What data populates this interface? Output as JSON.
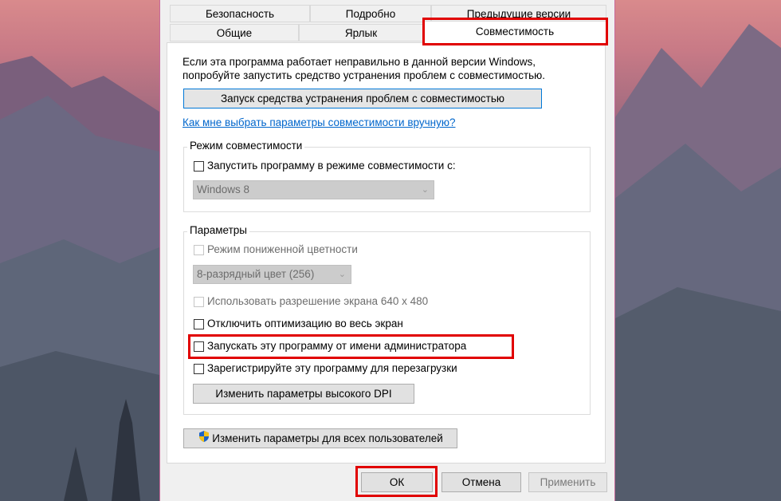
{
  "tabs": {
    "row1": [
      "Безопасность",
      "Подробно",
      "Предыдущие версии"
    ],
    "row2": [
      "Общие",
      "Ярлык",
      "Совместимость"
    ]
  },
  "description": {
    "line1": "Если эта программа работает неправильно в данной версии Windows,",
    "line2": "попробуйте запустить средство устранения проблем с совместимостью."
  },
  "troubleshooter_button": "Запуск средства устранения проблем с совместимостью",
  "manual_link": "Как мне выбрать параметры совместимости вручную?",
  "compat_mode": {
    "title": "Режим совместимости",
    "checkbox_label": "Запустить программу в режиме совместимости с:",
    "checked": false,
    "select_value": "Windows 8"
  },
  "settings": {
    "title": "Параметры",
    "reduced_color_label": "Режим пониженной цветности",
    "color_select_value": "8-разрядный цвет (256)",
    "resolution_label": "Использовать разрешение экрана 640 x 480",
    "fullscreen_opt_label": "Отключить оптимизацию во весь экран",
    "run_as_admin_label": "Запускать эту программу от имени администратора",
    "register_restart_label": "Зарегистрируйте эту программу для перезагрузки",
    "high_dpi_button": "Изменить параметры высокого DPI"
  },
  "all_users_button": "Изменить параметры для всех пользователей",
  "footer": {
    "ok": "ОК",
    "cancel": "Отмена",
    "apply": "Применить"
  },
  "colors": {
    "highlight": "#e10000",
    "link": "#0066cc",
    "disabled_text": "#6d6d6d"
  }
}
